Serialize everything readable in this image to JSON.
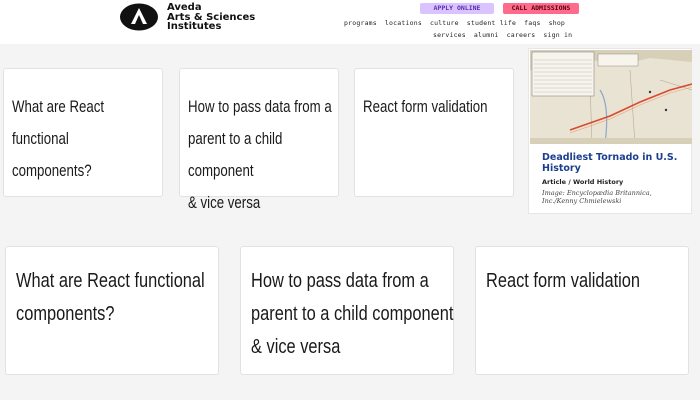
{
  "header": {
    "brand_line1": "Aveda",
    "brand_line2": "Arts & Sciences",
    "brand_line3": "Institutes",
    "apply_label": "APPLY ONLINE",
    "call_label": "CALL ADMISSIONS",
    "nav_row1": [
      "programs",
      "locations",
      "culture",
      "student life",
      "faqs",
      "shop"
    ],
    "nav_row2": [
      "services",
      "alumni",
      "careers",
      "sign in"
    ]
  },
  "row1": [
    {
      "lines": [
        "What are React functional",
        "components?"
      ]
    },
    {
      "lines": [
        "How to pass data from a",
        "parent to a child component",
        "& vice versa"
      ]
    },
    {
      "lines": [
        "React form validation"
      ]
    }
  ],
  "row2": [
    {
      "lines": [
        "What are React functional",
        "components?"
      ]
    },
    {
      "lines": [
        "How to pass data from a",
        "parent to a child component",
        "& vice versa"
      ]
    },
    {
      "lines": [
        "React form validation"
      ]
    }
  ],
  "article": {
    "title": "Deadliest Tornado in U.S. History",
    "category": "Article / World History",
    "credit": "Image: Encyclopædia Britannica, Inc./Kenny Chmielewski"
  },
  "colors": {
    "apply_bg": "#d9c4ff",
    "call_bg": "#ff6b8a",
    "article_title": "#1b3f8f",
    "tornado_track": "#d94b2b"
  }
}
